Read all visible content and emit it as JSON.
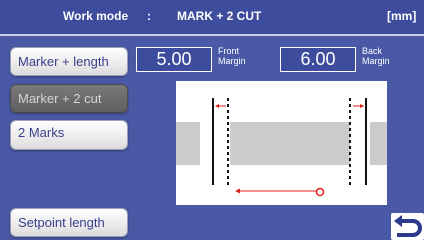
{
  "header": {
    "title": "Work mode",
    "separator": ":",
    "mode": "MARK + 2 CUT",
    "unit": "[mm]"
  },
  "modes": [
    {
      "label": "Marker + length",
      "active": false
    },
    {
      "label": "Marker + 2 cut",
      "active": true
    },
    {
      "label": "2 Marks",
      "active": false
    }
  ],
  "setpoint_button": "Setpoint length",
  "front_margin": {
    "value": "5.00",
    "label_line1": "Front",
    "label_line2": "Margin"
  },
  "back_margin": {
    "value": "6.00",
    "label_line1": "Back",
    "label_line2": "Margin"
  },
  "back_icon": "return-arrow-icon",
  "colors": {
    "header_bg": "#3d4c9d",
    "panel_bg": "#4a59a6",
    "arrow_red": "#e0201a",
    "active_button": "#6b6b6b"
  }
}
